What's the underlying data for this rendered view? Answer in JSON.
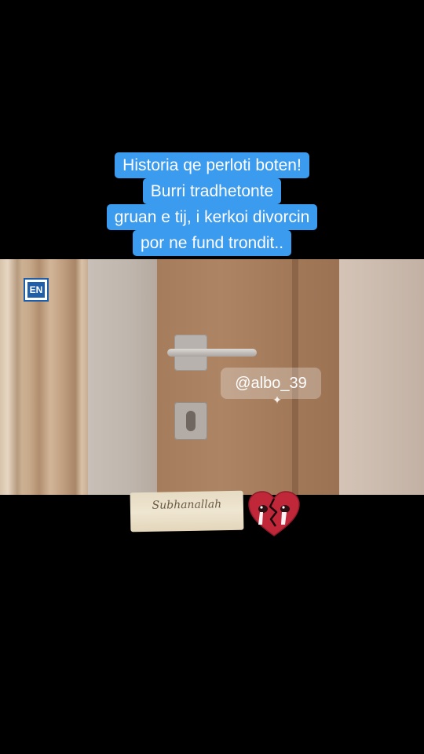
{
  "caption": {
    "lines": [
      "Historia qe perloti boten!",
      "Burri tradhetonte",
      "gruan e tij, i kerkoi divorcin",
      "por ne fund trondit.."
    ],
    "highlight_color": "#3b9bef"
  },
  "video": {
    "logo_text": "EN",
    "watermark": "@albo_39"
  },
  "stickers": {
    "subhanallah": "Subhanallah",
    "subhanallah_small": "",
    "heart_icon": "broken-heart-crying-icon",
    "heart_color": "#c0283a"
  }
}
